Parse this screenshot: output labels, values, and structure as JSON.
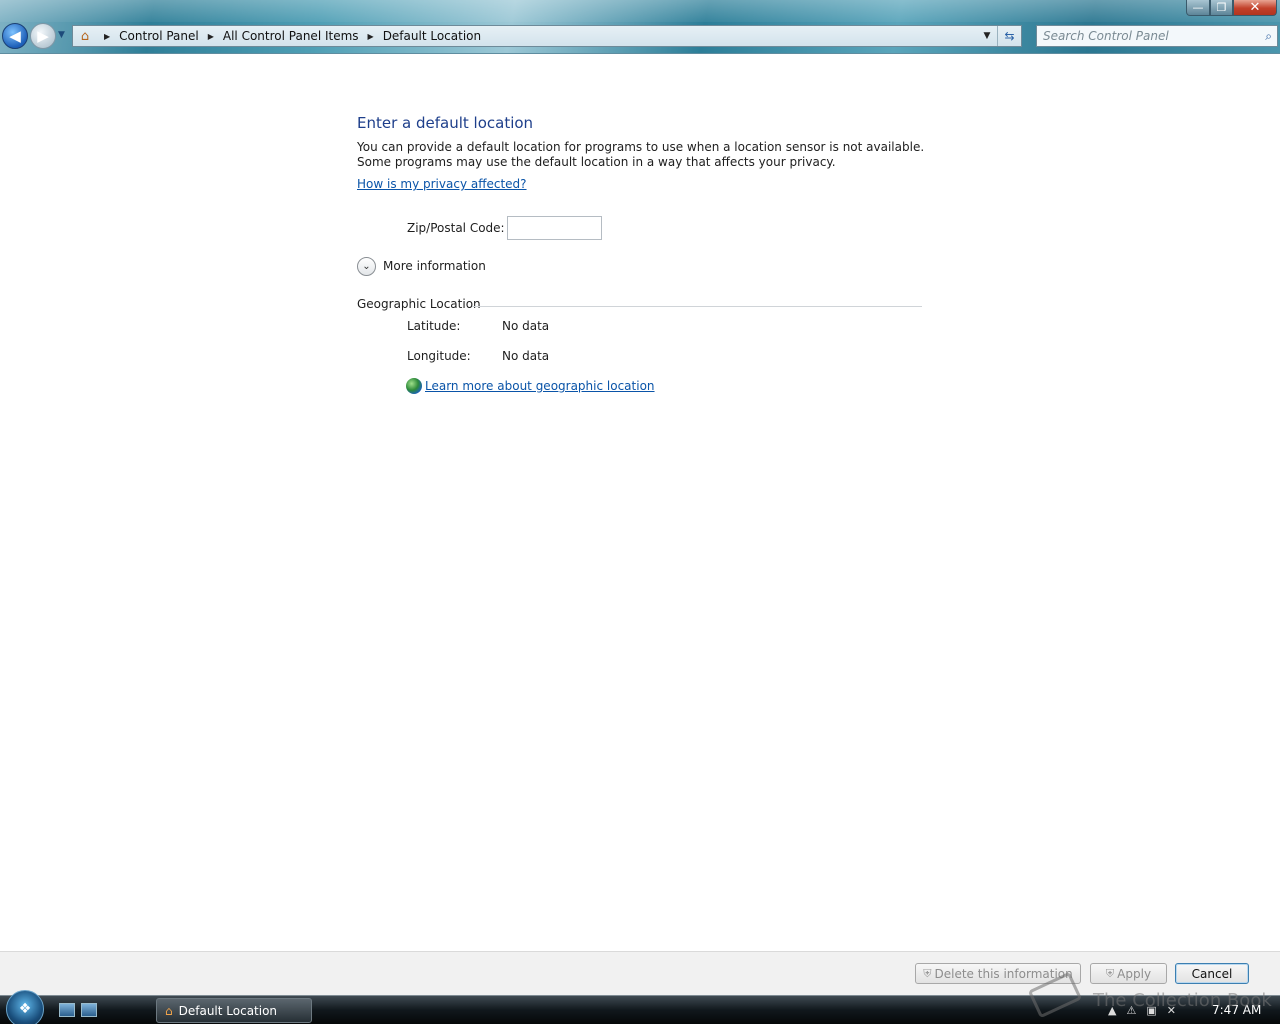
{
  "window": {
    "minimize_glyph": "—",
    "maximize_glyph": "❐",
    "close_glyph": "✕"
  },
  "address": {
    "crumbs": [
      "Control Panel",
      "All Control Panel Items",
      "Default Location"
    ]
  },
  "search": {
    "placeholder": "Search Control Panel"
  },
  "main": {
    "title": "Enter a default location",
    "description_line1": "You can provide a default location for programs to use when a location sensor is not available.",
    "description_line2": "Some programs may use the default location in a way that affects your privacy.",
    "privacy_link": "How is my privacy affected?",
    "zip_label": "Zip/Postal Code:",
    "zip_value": "",
    "more_info_label": "More information",
    "geo_heading": "Geographic Location",
    "latitude_label": "Latitude:",
    "latitude_value": "No data",
    "longitude_label": "Longitude:",
    "longitude_value": "No data",
    "geo_link": "Learn more about geographic location"
  },
  "footer": {
    "delete_label": "Delete this information",
    "apply_label": "Apply",
    "cancel_label": "Cancel"
  },
  "taskbar": {
    "task_label": "Default Location",
    "clock": "7:47 AM"
  },
  "watermark": "The Collection Book",
  "icons": {
    "back": "back-arrow-icon",
    "forward": "forward-arrow-icon",
    "home": "control-panel-icon",
    "search": "search-icon",
    "globe": "globe-icon",
    "shield": "uac-shield-icon"
  }
}
